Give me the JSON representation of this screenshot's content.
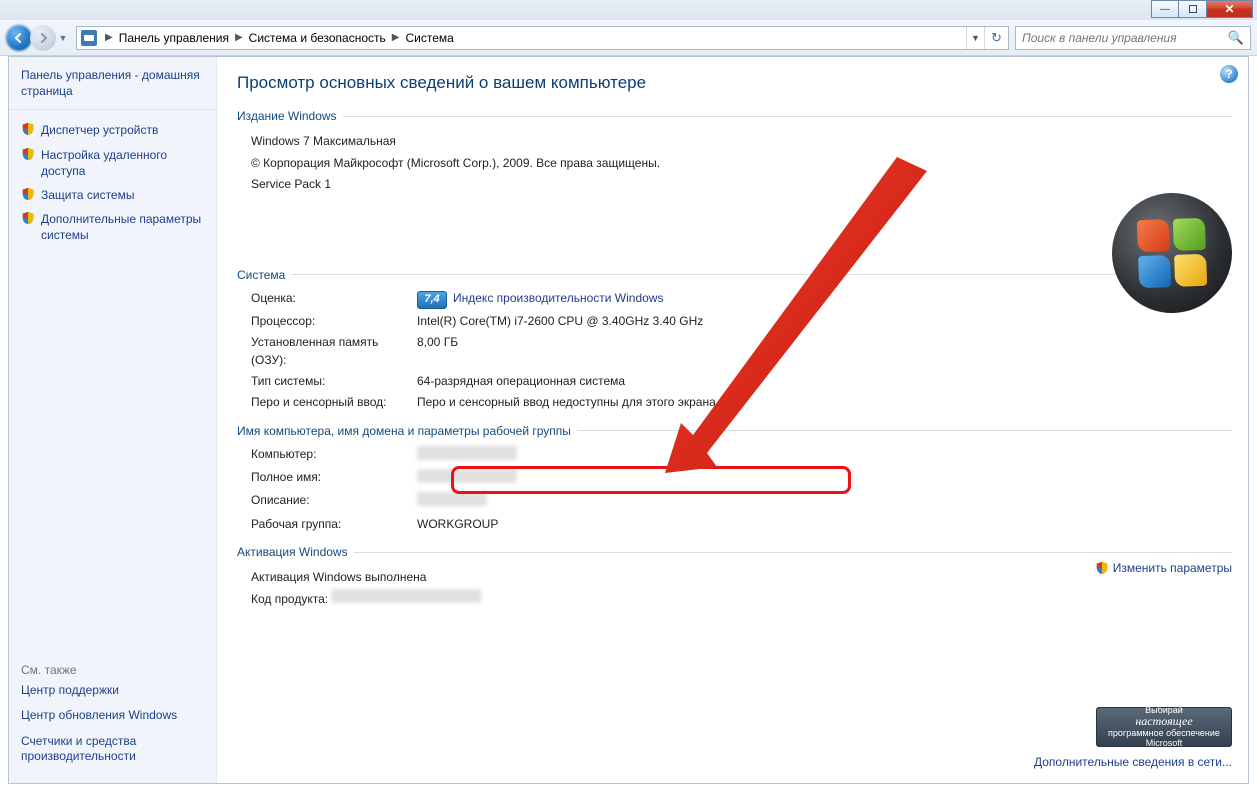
{
  "titlebar": {
    "min": "—",
    "max": "",
    "close": "✕"
  },
  "nav": {
    "crumb1": "Панель управления",
    "crumb2": "Система и безопасность",
    "crumb3": "Система"
  },
  "search": {
    "placeholder": "Поиск в панели управления"
  },
  "sidebar": {
    "home": "Панель управления - домашняя страница",
    "links": [
      "Диспетчер устройств",
      "Настройка удаленного доступа",
      "Защита системы",
      "Дополнительные параметры системы"
    ],
    "seealso_hdr": "См. также",
    "seealso": [
      "Центр поддержки",
      "Центр обновления Windows",
      "Счетчики и средства производительности"
    ]
  },
  "content": {
    "title": "Просмотр основных сведений о вашем компьютере",
    "g_edition": "Издание Windows",
    "edition_name": "Windows 7 Максимальная",
    "copyright": "© Корпорация Майкрософт (Microsoft Corp.), 2009. Все права защищены.",
    "sp": "Service Pack 1",
    "g_system": "Система",
    "k_rating": "Оценка:",
    "rating_badge": "7,4",
    "rating_link": "Индекс производительности Windows",
    "k_cpu": "Процессор:",
    "v_cpu": "Intel(R) Core(TM) i7-2600 CPU @ 3.40GHz   3.40 GHz",
    "k_ram": "Установленная память (ОЗУ):",
    "v_ram": "8,00 ГБ",
    "k_type": "Тип системы:",
    "v_type": "64-разрядная операционная система",
    "k_pen": "Перо и сенсорный ввод:",
    "v_pen": "Перо и сенсорный ввод недоступны для этого экрана",
    "g_name": "Имя компьютера, имя домена и параметры рабочей группы",
    "k_comp": "Компьютер:",
    "k_full": "Полное имя:",
    "k_desc": "Описание:",
    "k_wg": "Рабочая группа:",
    "v_wg": "WORKGROUP",
    "change": "Изменить параметры",
    "g_act": "Активация Windows",
    "act_done": "Активация Windows выполнена",
    "k_pid": "Код продукта:",
    "genuine_top": "Выбирай",
    "genuine_mid": "настоящее",
    "genuine_bot": "программное обеспечение Microsoft",
    "more": "Дополнительные сведения в сети..."
  }
}
